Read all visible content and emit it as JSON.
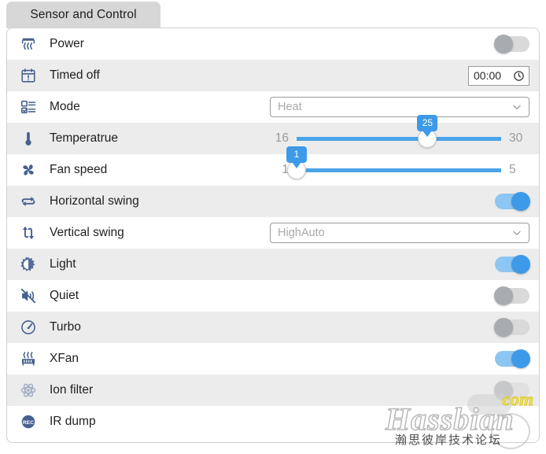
{
  "tab": {
    "label": "Sensor and Control"
  },
  "rows": [
    {
      "key": "power",
      "icon": "heater-icon",
      "label": "Power",
      "control": "toggle",
      "state": "off"
    },
    {
      "key": "timed-off",
      "icon": "calendar-alert-icon",
      "label": "Timed off",
      "control": "time",
      "value": "00:00",
      "trailing_icon": "clock-icon"
    },
    {
      "key": "mode",
      "icon": "list-checkbox-icon",
      "label": "Mode",
      "control": "select",
      "value": "Heat",
      "trailing_icon": "chevron-down-icon"
    },
    {
      "key": "temperature",
      "icon": "thermometer-icon",
      "label": "Temperatrue",
      "control": "slider",
      "min": "16",
      "max": "30",
      "value": "25",
      "percent": 64
    },
    {
      "key": "fan-speed",
      "icon": "fan-icon",
      "label": "Fan speed",
      "control": "slider",
      "min": "1",
      "max": "5",
      "value": "1",
      "percent": 0
    },
    {
      "key": "horizontal-swing",
      "icon": "horizontal-arrows-icon",
      "label": "Horizontal swing",
      "control": "toggle",
      "state": "on"
    },
    {
      "key": "vertical-swing",
      "icon": "vertical-arrows-icon",
      "label": "Vertical swing",
      "control": "select",
      "value": "HighAuto",
      "trailing_icon": "chevron-down-icon"
    },
    {
      "key": "light",
      "icon": "brightness-icon",
      "label": "Light",
      "control": "toggle",
      "state": "on"
    },
    {
      "key": "quiet",
      "icon": "mute-icon",
      "label": "Quiet",
      "control": "toggle",
      "state": "off"
    },
    {
      "key": "turbo",
      "icon": "gauge-icon",
      "label": "Turbo",
      "control": "toggle",
      "state": "off"
    },
    {
      "key": "xfan",
      "icon": "radiator-icon",
      "label": "XFan",
      "control": "toggle",
      "state": "on"
    },
    {
      "key": "ion-filter",
      "icon": "atom-icon",
      "label": "Ion filter",
      "control": "toggle",
      "state": "off",
      "disabled": true
    },
    {
      "key": "ir-dump",
      "icon": "rec-icon",
      "label": "IR dump",
      "control": "none"
    }
  ],
  "colors": {
    "accent": "#3d9ae8",
    "slider_track": "#4aa3e8",
    "toggle_on_bg": "#8dc6f2",
    "toggle_off_bg": "#d9d9d9",
    "toggle_off_knob": "#a8acb0",
    "row_alt_bg": "#ececec",
    "tab_bg": "#d7d7d7",
    "icon": "#46618f",
    "muted_text": "#a9a9a9"
  },
  "watermark": {
    "brand": "Hassbian",
    "tld": "com",
    "subtitle": "瀚思彼岸技术论坛"
  }
}
